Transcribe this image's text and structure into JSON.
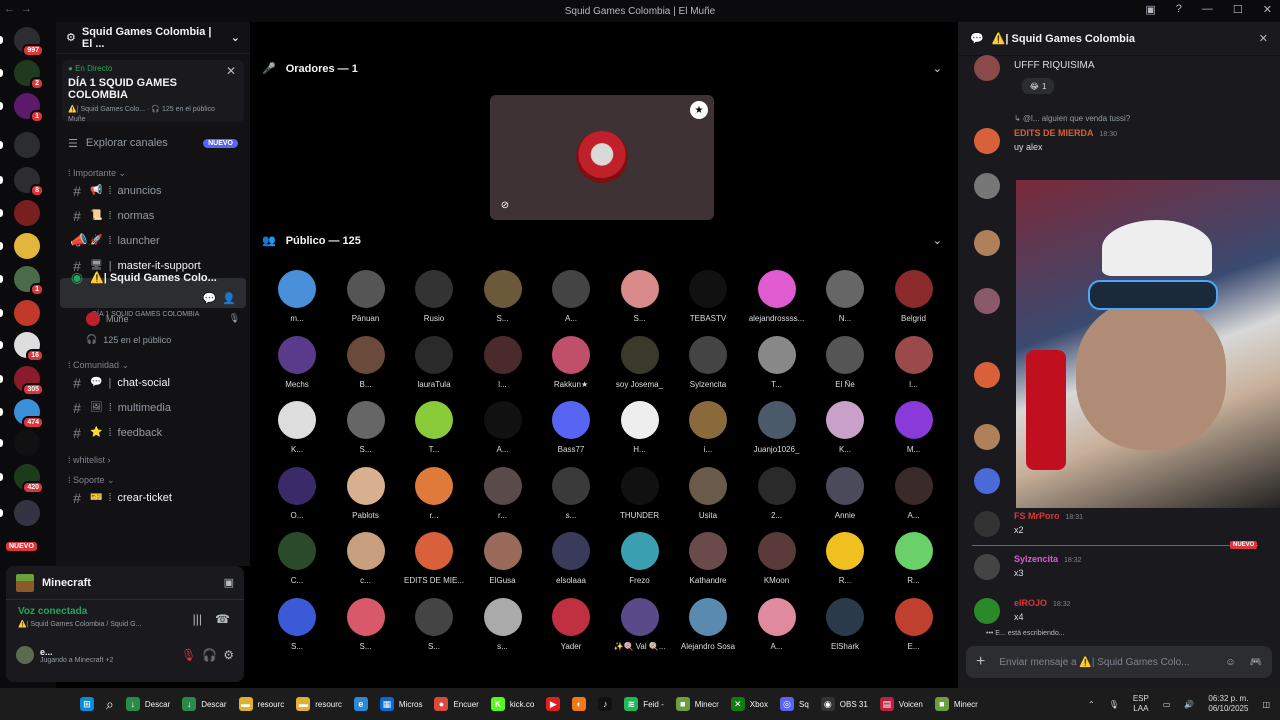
{
  "window": {
    "title": "Squid Games Colombia | El Muñe"
  },
  "guilds": [
    {
      "badge": "997",
      "color": "#2b2d31"
    },
    {
      "badge": "2",
      "color": "#1f3a1f"
    },
    {
      "badge": "1",
      "color": "#5b1a6b"
    },
    {
      "badge": "",
      "color": "#2b2d31"
    },
    {
      "badge": "8",
      "color": "#2b2d31"
    },
    {
      "badge": "",
      "color": "#7a1f1f"
    },
    {
      "badge": "",
      "color": "#e2b53b"
    },
    {
      "badge": "1",
      "color": "#4a6b4a"
    },
    {
      "badge": "",
      "color": "#c0392b"
    },
    {
      "badge": "16",
      "color": "#ddd"
    },
    {
      "badge": "305",
      "color": "#8b1a2a"
    },
    {
      "badge": "474",
      "color": "#3a8fd8"
    },
    {
      "badge": "",
      "color": "#111"
    },
    {
      "badge": "420",
      "color": "#1b3b1b"
    },
    {
      "badge": "",
      "color": "#334"
    }
  ],
  "guilds_new": "NUEVO",
  "server": {
    "name": "Squid Games Colombia | El ..."
  },
  "live": {
    "status": "En Directo",
    "title": "DÍA 1 SQUID GAMES COLOMBIA",
    "channel": "⚠️| Squid Games Colo...",
    "listeners": "125 en el público",
    "host": "Muñe"
  },
  "explore": {
    "label": "Explorar canales",
    "badge": "NUEVO"
  },
  "categories": {
    "importante": "Importante",
    "comunidad": "Comunidad",
    "whitelist": "whitelist",
    "soporte": "Soporte"
  },
  "channels": {
    "anuncios": "anuncios",
    "normas": "normas",
    "launcher": "launcher",
    "master": "master-it-support",
    "active": "Squid Games Colo...",
    "active_sub": "DÍA 1 SQUID GAMES COLOMBIA",
    "sub_user": "Muñe",
    "sub_public": "125 en el público",
    "chat": "chat-social",
    "multimedia": "multimedia",
    "feedback": "feedback",
    "ticket": "crear-ticket"
  },
  "userpanel": {
    "game": "Minecraft",
    "voice": "Voz conectada",
    "voice_sub": "⚠️| Squid Games Colombia / Squid G...",
    "user": "e...",
    "user_status": "Jugando a Minecraft +2"
  },
  "stage": {
    "speakers_header": "Oradores — 1",
    "public_header": "Público — 125"
  },
  "audience": [
    {
      "name": "m...",
      "color": "#4a90d9"
    },
    {
      "name": "Pānuan",
      "color": "#555"
    },
    {
      "name": "Rusio",
      "color": "#333"
    },
    {
      "name": "S...",
      "color": "#6a5a3a"
    },
    {
      "name": "A...",
      "color": "#444"
    },
    {
      "name": "S...",
      "color": "#d98a8a"
    },
    {
      "name": "TEBASTV",
      "color": "#111"
    },
    {
      "name": "alejandrossss...",
      "color": "#e05ad0"
    },
    {
      "name": "N...",
      "color": "#666"
    },
    {
      "name": "Belgrid",
      "color": "#8a2a2a"
    },
    {
      "name": "Mechs",
      "color": "#5a3a8a"
    },
    {
      "name": "B...",
      "color": "#6a4a3a"
    },
    {
      "name": "lauraTula",
      "color": "#2a2a2a"
    },
    {
      "name": "l...",
      "color": "#4a2a2a"
    },
    {
      "name": "Rakkun★",
      "color": "#c0506a"
    },
    {
      "name": "soy Josema_",
      "color": "#3a3a2a"
    },
    {
      "name": "Sylzencita",
      "color": "#444"
    },
    {
      "name": "T...",
      "color": "#888"
    },
    {
      "name": "El Ñe",
      "color": "#555"
    },
    {
      "name": "l...",
      "color": "#9a4a4a"
    },
    {
      "name": "K...",
      "color": "#ddd"
    },
    {
      "name": "S...",
      "color": "#666"
    },
    {
      "name": "T...",
      "color": "#8acb3a"
    },
    {
      "name": "A...",
      "color": "#111"
    },
    {
      "name": "Bass77",
      "color": "#5865f2"
    },
    {
      "name": "H...",
      "color": "#eee"
    },
    {
      "name": "i...",
      "color": "#8a6a3a"
    },
    {
      "name": "Juanjo1026_",
      "color": "#4a5a6a"
    },
    {
      "name": "K...",
      "color": "#c8a0c8"
    },
    {
      "name": "M...",
      "color": "#8a3ad8"
    },
    {
      "name": "O...",
      "color": "#3a2a6a"
    },
    {
      "name": "Pablots",
      "color": "#d8b090"
    },
    {
      "name": "r...",
      "color": "#e07a3a"
    },
    {
      "name": "r...",
      "color": "#5a4a4a"
    },
    {
      "name": "s...",
      "color": "#3a3a3a"
    },
    {
      "name": "THUNDER",
      "color": "#111"
    },
    {
      "name": "Usita",
      "color": "#6a5a4a"
    },
    {
      "name": "2...",
      "color": "#2a2a2a"
    },
    {
      "name": "Annie",
      "color": "#4a4a5a"
    },
    {
      "name": "A...",
      "color": "#3a2a2a"
    },
    {
      "name": "C...",
      "color": "#2a4a2a"
    },
    {
      "name": "c...",
      "color": "#c8a080"
    },
    {
      "name": "EDITS DE MIE...",
      "color": "#d8603a"
    },
    {
      "name": "ElGusa",
      "color": "#9a6a5a"
    },
    {
      "name": "elsolaaa",
      "color": "#3a3a5a"
    },
    {
      "name": "Frezo",
      "color": "#3aa0b0"
    },
    {
      "name": "Kathandre",
      "color": "#6a4a4a"
    },
    {
      "name": "KMoon",
      "color": "#5a3a3a"
    },
    {
      "name": "R...",
      "color": "#f0c020"
    },
    {
      "name": "R...",
      "color": "#6ad06a"
    },
    {
      "name": "S...",
      "color": "#3a5ad8"
    },
    {
      "name": "S...",
      "color": "#d85a6a"
    },
    {
      "name": "S...",
      "color": "#444"
    },
    {
      "name": "s...",
      "color": "#aaa"
    },
    {
      "name": "Yader",
      "color": "#c03040"
    },
    {
      "name": "✨🍭 Val 🍭...",
      "color": "#5a4a8a"
    },
    {
      "name": "Alejandro Sosa",
      "color": "#5a8ab0"
    },
    {
      "name": "A...",
      "color": "#e08aa0"
    },
    {
      "name": "ElShark",
      "color": "#2a3a4a"
    },
    {
      "name": "E...",
      "color": "#c04030"
    }
  ],
  "chat": {
    "title": "⚠️| Squid Games Colombia",
    "messages": [
      {
        "user": "",
        "time": "",
        "text": "UFFF RIQUISIMA",
        "color": "#f2f3f5",
        "avatar": "#8a4a4a"
      },
      {
        "user": "EDITS DE MIERDA",
        "time": "18:30",
        "text": "uy alex",
        "reply": "alguien que venda tussi?",
        "color": "#d8603a",
        "avatar": "#d8603a"
      },
      {
        "user": "FS MrPoro",
        "time": "18:31",
        "text": "x2",
        "color": "#da373c",
        "avatar": "#333"
      },
      {
        "user": "Sylzencita",
        "time": "18:32",
        "text": "x3",
        "color": "#e05ad0",
        "avatar": "#444"
      },
      {
        "user": "elROJO",
        "time": "18:32",
        "text": "x4",
        "color": "#da373c",
        "avatar": "#2a8a2a"
      }
    ],
    "reaction_count": "1",
    "new_tag": "NUEVO",
    "typing": "E... está escribiendo...",
    "composer_placeholder": "Enviar mensaje a ⚠️| Squid Games Colo..."
  },
  "taskbar": {
    "items": [
      {
        "label": "Descar",
        "color": "#2a8a4a",
        "glyph": "↓"
      },
      {
        "label": "Descar",
        "color": "#2a8a4a",
        "glyph": "↓"
      },
      {
        "label": "resourc",
        "color": "#e0b030",
        "glyph": "▬"
      },
      {
        "label": "resourc",
        "color": "#e0b030",
        "glyph": "▬"
      },
      {
        "label": "",
        "color": "#2a8ad8",
        "glyph": "e"
      },
      {
        "label": "Micros",
        "color": "#0a6ad8",
        "glyph": "▦"
      },
      {
        "label": "Encuer",
        "color": "#d84a3a",
        "glyph": "●"
      },
      {
        "label": "kick.co",
        "color": "#53fc18",
        "glyph": "K"
      },
      {
        "label": "",
        "color": "#e02020",
        "glyph": "▶"
      },
      {
        "label": "",
        "color": "#f07a1a",
        "glyph": "◐"
      },
      {
        "label": "",
        "color": "#111",
        "glyph": "♪"
      },
      {
        "label": "Feid -",
        "color": "#1db954",
        "glyph": "≋"
      },
      {
        "label": "Minecr",
        "color": "#6a9f3c",
        "glyph": "■"
      },
      {
        "label": "Xbox",
        "color": "#107c10",
        "glyph": "✕"
      },
      {
        "label": "Sq",
        "color": "#5865f2",
        "glyph": "◎"
      },
      {
        "label": "OBS 31",
        "color": "#333",
        "glyph": "◉"
      },
      {
        "label": "Voicen",
        "color": "#c02040",
        "glyph": "▤"
      },
      {
        "label": "Minecr",
        "color": "#6a9f3c",
        "glyph": "■"
      }
    ],
    "lang": "ESP",
    "lang2": "LAA",
    "time": "06:32 p. m.",
    "date": "06/10/2025"
  }
}
